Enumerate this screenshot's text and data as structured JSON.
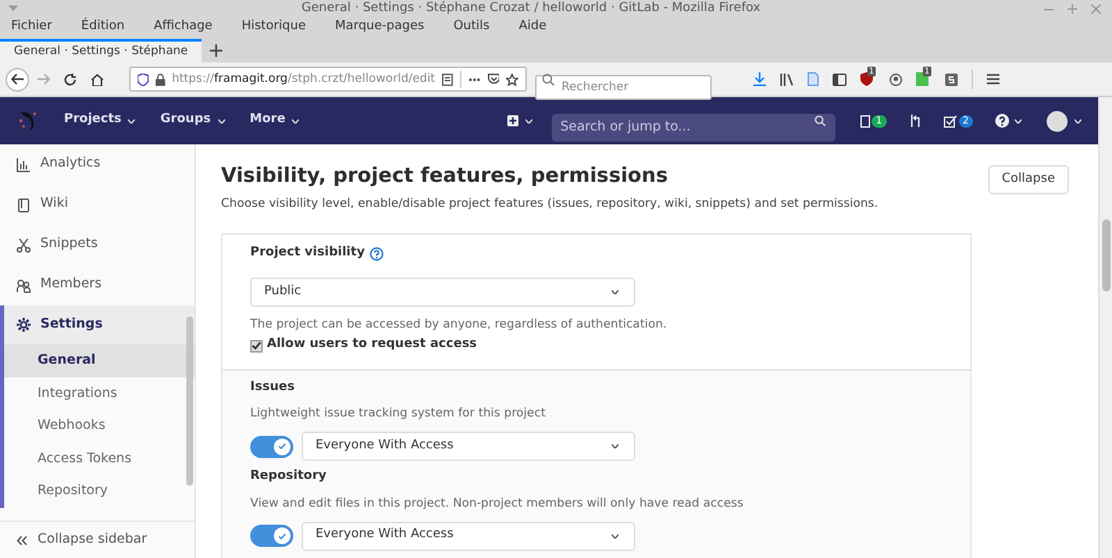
{
  "window": {
    "title": "General · Settings · Stéphane Crozat / helloworld · GitLab - Mozilla Firefox"
  },
  "menu": [
    "Fichier",
    "Édition",
    "Affichage",
    "Historique",
    "Marque-pages",
    "Outils",
    "Aide"
  ],
  "tabs": [
    {
      "label": "General · Settings · Stéphane",
      "selected": true
    }
  ],
  "url": {
    "scheme": "https://",
    "host": "framagit.org",
    "path": "/stph.crzt/helloworld/edit"
  },
  "browser_search": {
    "placeholder": "Rechercher"
  },
  "extension_badges": [
    "1",
    "1"
  ],
  "gitlab_nav": {
    "items": [
      "Projects",
      "Groups",
      "More"
    ],
    "search": {
      "placeholder": "Search or jump to..."
    },
    "counters": [
      {
        "kind": "issues",
        "count": "1",
        "color": "#1aaa55"
      },
      {
        "kind": "merge_requests"
      },
      {
        "kind": "todos",
        "count": "2",
        "color": "#1f78d1"
      }
    ]
  },
  "sidebar": {
    "items": [
      {
        "label": "Analytics",
        "kind": "analytics",
        "selected": false
      },
      {
        "label": "Wiki",
        "kind": "wiki",
        "selected": false
      },
      {
        "label": "Snippets",
        "kind": "snippets",
        "selected": false
      },
      {
        "label": "Members",
        "kind": "members",
        "selected": false
      },
      {
        "label": "Settings",
        "kind": "settings",
        "selected": true,
        "children": [
          {
            "label": "General",
            "selected": true
          },
          {
            "label": "Integrations",
            "selected": false
          },
          {
            "label": "Webhooks",
            "selected": false
          },
          {
            "label": "Access Tokens",
            "selected": false
          },
          {
            "label": "Repository",
            "selected": false
          }
        ]
      }
    ],
    "collapse": "Collapse sidebar"
  },
  "section": {
    "title": "Visibility, project features, permissions",
    "description": "Choose visibility level, enable/disable project features (issues, repository, wiki, snippets) and set permissions.",
    "button": "Collapse",
    "visibility": {
      "label": "Project visibility",
      "value": "Public",
      "help": "The project can be accessed by anyone, regardless of authentication.",
      "checkbox": {
        "label": "Allow users to request access",
        "checked": true
      }
    },
    "features": [
      {
        "name": "Issues",
        "description": "Lightweight issue tracking system for this project",
        "on": true,
        "value": "Everyone With Access"
      },
      {
        "name": "Repository",
        "description": "View and edit files in this project. Non-project members will only have read access",
        "on": true,
        "value": "Everyone With Access"
      }
    ]
  }
}
